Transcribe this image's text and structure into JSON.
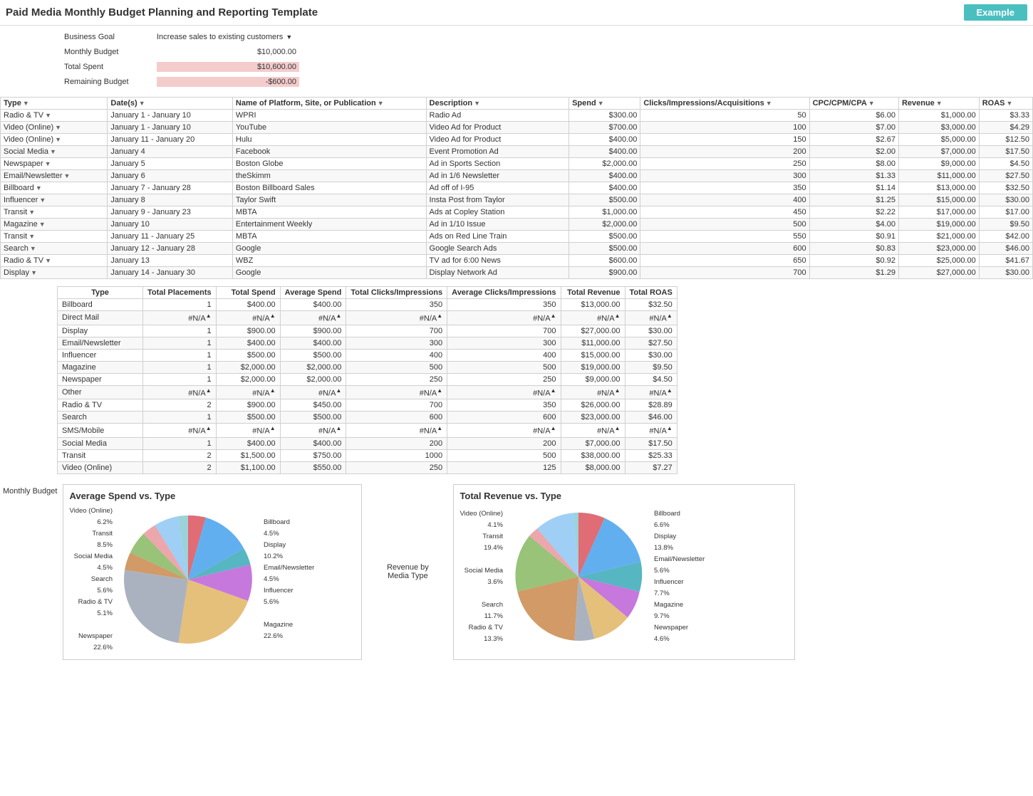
{
  "header": {
    "title": "Paid Media Monthly Budget Planning and Reporting Template",
    "example_label": "Example"
  },
  "info": {
    "business_goal_label": "Business Goal",
    "business_goal_value": "Increase sales to existing customers",
    "monthly_budget_label": "Monthly Budget",
    "monthly_budget_value": "$10,000.00",
    "total_spent_label": "Total Spent",
    "total_spent_value": "$10,600.00",
    "remaining_budget_label": "Remaining Budget",
    "remaining_budget_value": "-$600.00"
  },
  "main_table": {
    "headers": [
      "Type",
      "Date(s)",
      "Name of Platform, Site, or Publication",
      "Description",
      "Spend",
      "Clicks/Impressions/Acquisitions",
      "CPC/CPM/CPA",
      "Revenue",
      "ROAS"
    ],
    "rows": [
      [
        "Radio & TV",
        "January 1 - January 10",
        "WPRI",
        "Radio Ad",
        "$300.00",
        "50",
        "$6.00",
        "$1,000.00",
        "$3.33"
      ],
      [
        "Video (Online)",
        "January 1 - January 10",
        "YouTube",
        "Video Ad for Product",
        "$700.00",
        "100",
        "$7.00",
        "$3,000.00",
        "$4.29"
      ],
      [
        "Video (Online)",
        "January 11 - January 20",
        "Hulu",
        "Video Ad for Product",
        "$400.00",
        "150",
        "$2.67",
        "$5,000.00",
        "$12.50"
      ],
      [
        "Social Media",
        "January 4",
        "Facebook",
        "Event Promotion Ad",
        "$400.00",
        "200",
        "$2.00",
        "$7,000.00",
        "$17.50"
      ],
      [
        "Newspaper",
        "January 5",
        "Boston Globe",
        "Ad in Sports Section",
        "$2,000.00",
        "250",
        "$8.00",
        "$9,000.00",
        "$4.50"
      ],
      [
        "Email/Newsletter",
        "January 6",
        "theSkimm",
        "Ad in 1/6 Newsletter",
        "$400.00",
        "300",
        "$1.33",
        "$11,000.00",
        "$27.50"
      ],
      [
        "Billboard",
        "January 7 - January 28",
        "Boston Billboard Sales",
        "Ad off of I-95",
        "$400.00",
        "350",
        "$1.14",
        "$13,000.00",
        "$32.50"
      ],
      [
        "Influencer",
        "January 8",
        "Taylor Swift",
        "Insta Post from Taylor",
        "$500.00",
        "400",
        "$1.25",
        "$15,000.00",
        "$30.00"
      ],
      [
        "Transit",
        "January 9 - January 23",
        "MBTA",
        "Ads at Copley Station",
        "$1,000.00",
        "450",
        "$2.22",
        "$17,000.00",
        "$17.00"
      ],
      [
        "Magazine",
        "January 10",
        "Entertainment Weekly",
        "Ad in 1/10 Issue",
        "$2,000.00",
        "500",
        "$4.00",
        "$19,000.00",
        "$9.50"
      ],
      [
        "Transit",
        "January 11 - January 25",
        "MBTA",
        "Ads on Red Line Train",
        "$500.00",
        "550",
        "$0.91",
        "$21,000.00",
        "$42.00"
      ],
      [
        "Search",
        "January 12 - January 28",
        "Google",
        "Google Search Ads",
        "$500.00",
        "600",
        "$0.83",
        "$23,000.00",
        "$46.00"
      ],
      [
        "Radio & TV",
        "January 13",
        "WBZ",
        "TV ad for 6:00 News",
        "$600.00",
        "650",
        "$0.92",
        "$25,000.00",
        "$41.67"
      ],
      [
        "Display",
        "January 14 - January 30",
        "Google",
        "Display Network Ad",
        "$900.00",
        "700",
        "$1.29",
        "$27,000.00",
        "$30.00"
      ]
    ]
  },
  "summary_table": {
    "headers": [
      "Type",
      "Total Placements",
      "Total Spend",
      "Average Spend",
      "Total Clicks/Impressions",
      "Average Clicks/Impressions",
      "Total Revenue",
      "Total ROAS"
    ],
    "rows": [
      [
        "Billboard",
        "1",
        "$400.00",
        "$400.00",
        "350",
        "350",
        "$13,000.00",
        "$32.50"
      ],
      [
        "Direct Mail",
        "#N/A",
        "#N/A",
        "#N/A",
        "#N/A",
        "#N/A",
        "#N/A",
        "#N/A"
      ],
      [
        "Display",
        "1",
        "$900.00",
        "$900.00",
        "700",
        "700",
        "$27,000.00",
        "$30.00"
      ],
      [
        "Email/Newsletter",
        "1",
        "$400.00",
        "$400.00",
        "300",
        "300",
        "$11,000.00",
        "$27.50"
      ],
      [
        "Influencer",
        "1",
        "$500.00",
        "$500.00",
        "400",
        "400",
        "$15,000.00",
        "$30.00"
      ],
      [
        "Magazine",
        "1",
        "$2,000.00",
        "$2,000.00",
        "500",
        "500",
        "$19,000.00",
        "$9.50"
      ],
      [
        "Newspaper",
        "1",
        "$2,000.00",
        "$2,000.00",
        "250",
        "250",
        "$9,000.00",
        "$4.50"
      ],
      [
        "Other",
        "#N/A",
        "#N/A",
        "#N/A",
        "#N/A",
        "#N/A",
        "#N/A",
        "#N/A"
      ],
      [
        "Radio & TV",
        "2",
        "$900.00",
        "$450.00",
        "700",
        "350",
        "$26,000.00",
        "$28.89"
      ],
      [
        "Search",
        "1",
        "$500.00",
        "$500.00",
        "600",
        "600",
        "$23,000.00",
        "$46.00"
      ],
      [
        "SMS/Mobile",
        "#N/A",
        "#N/A",
        "#N/A",
        "#N/A",
        "#N/A",
        "#N/A",
        "#N/A"
      ],
      [
        "Social Media",
        "1",
        "$400.00",
        "$400.00",
        "200",
        "200",
        "$7,000.00",
        "$17.50"
      ],
      [
        "Transit",
        "2",
        "$1,500.00",
        "$750.00",
        "1000",
        "500",
        "$38,000.00",
        "$25.33"
      ],
      [
        "Video (Online)",
        "2",
        "$1,100.00",
        "$550.00",
        "250",
        "125",
        "$8,000.00",
        "$7.27"
      ]
    ]
  },
  "charts": {
    "left": {
      "title": "Average Spend vs. Type",
      "monthly_budget_label": "Monthly Budget",
      "legend_left": [
        {
          "label": "Video (Online)",
          "pct": "6.2%"
        },
        {
          "label": "Transit",
          "pct": "8.5%"
        },
        {
          "label": "Social Media",
          "pct": "4.5%"
        },
        {
          "label": "Search",
          "pct": "5.6%"
        },
        {
          "label": "Radio & TV",
          "pct": "5.1%"
        },
        {
          "label": "",
          "pct": ""
        },
        {
          "label": "Newspaper",
          "pct": "22.6%"
        }
      ],
      "legend_right": [
        {
          "label": "Billboard",
          "pct": "4.5%"
        },
        {
          "label": "Display",
          "pct": "10.2%"
        },
        {
          "label": "Email/Newsletter",
          "pct": "4.5%"
        },
        {
          "label": "Influencer",
          "pct": "5.6%"
        },
        {
          "label": "",
          "pct": ""
        },
        {
          "label": "Magazine",
          "pct": "22.6%"
        }
      ]
    },
    "middle": {
      "label": "Revenue by Media Type"
    },
    "right": {
      "title": "Total Revenue vs. Type",
      "legend_left": [
        {
          "label": "Video (Online)",
          "pct": "4.1%"
        },
        {
          "label": "Transit",
          "pct": "19.4%"
        },
        {
          "label": "",
          "pct": ""
        },
        {
          "label": "Social Media",
          "pct": "3.6%"
        },
        {
          "label": "",
          "pct": ""
        },
        {
          "label": "Search",
          "pct": "11.7%"
        },
        {
          "label": "Radio & TV",
          "pct": "13.3%"
        }
      ],
      "legend_right": [
        {
          "label": "Billboard",
          "pct": "6.6%"
        },
        {
          "label": "Display",
          "pct": "13.8%"
        },
        {
          "label": "Email/Newsletter",
          "pct": "5.6%"
        },
        {
          "label": "Influencer",
          "pct": "7.7%"
        },
        {
          "label": "Magazine",
          "pct": "9.7%"
        },
        {
          "label": "Newspaper",
          "pct": "4.6%"
        }
      ]
    }
  }
}
